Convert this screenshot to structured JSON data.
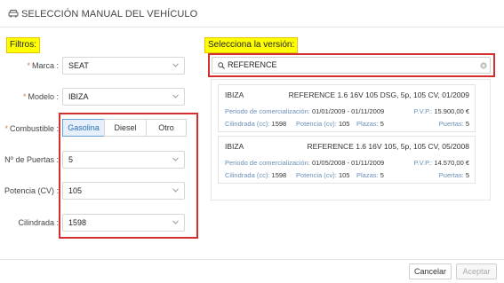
{
  "dialog": {
    "title": "SELECCIÓN MANUAL DEL VEHÍCULO"
  },
  "filters": {
    "tag": "Filtros:",
    "marca": {
      "label": "Marca :",
      "value": "SEAT"
    },
    "modelo": {
      "label": "Modelo :",
      "value": "IBIZA"
    },
    "combustible": {
      "label": "Combustible :",
      "options": [
        "Gasolina",
        "Diesel",
        "Otro"
      ],
      "selected": "Gasolina"
    },
    "puertas": {
      "label": "Nº de Puertas :",
      "value": "5"
    },
    "potencia": {
      "label": "Potencia (CV) :",
      "value": "105"
    },
    "cilindrada": {
      "label": "Cilindrada :",
      "value": "1598"
    }
  },
  "version": {
    "tag": "Selecciona la versión:",
    "search_value": "REFERENCE",
    "results": [
      {
        "model": "IBIZA",
        "version": "REFERENCE 1.6 16V 105 DSG, 5p, 105 CV, 01/2009",
        "period_label": "Periodo de comercialización:",
        "period": "01/01/2009 - 01/11/2009",
        "pvp_label": "P.V.P.:",
        "pvp": "15.900,00 €",
        "cc_label": "Cilindrada (cc):",
        "cc": "1598",
        "power_label": "Potencia (cv):",
        "power": "105",
        "seats_label": "Plazas:",
        "seats": "5",
        "doors_label": "Puertas:",
        "doors": "5"
      },
      {
        "model": "IBIZA",
        "version": "REFERENCE 1.6 16V 105, 5p, 105 CV, 05/2008",
        "period_label": "Periodo de comercialización:",
        "period": "01/05/2008 - 01/11/2009",
        "pvp_label": "P.V.P.:",
        "pvp": "14.570,00 €",
        "cc_label": "Cilindrada (cc):",
        "cc": "1598",
        "power_label": "Potencia (cv):",
        "power": "105",
        "seats_label": "Plazas:",
        "seats": "5",
        "doors_label": "Puertas:",
        "doors": "5"
      }
    ]
  },
  "footer": {
    "cancel": "Cancelar",
    "accept": "Aceptar"
  },
  "colors": {
    "highlight": "#ffff00",
    "red_box": "#d32f2f",
    "accent": "#2d6fb5",
    "required": "#e07b39"
  },
  "icons": [
    "car-icon",
    "search-icon",
    "clear-icon",
    "chevron-down-icon"
  ]
}
